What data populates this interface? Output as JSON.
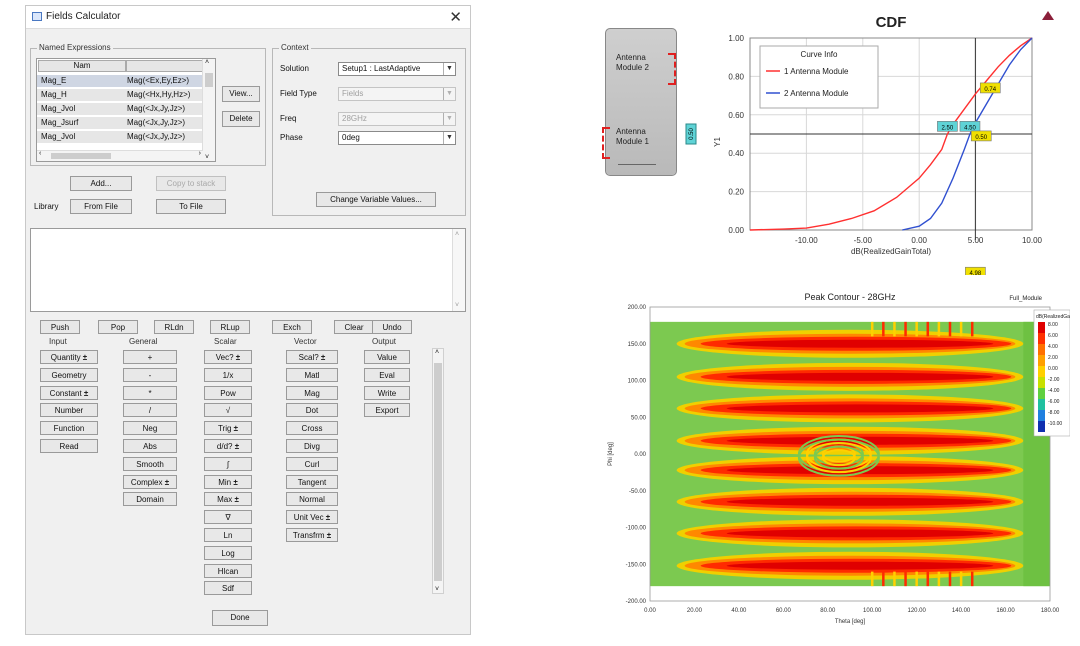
{
  "calculator": {
    "title": "Fields Calculator",
    "named_expression_group": "Named Expressions",
    "table_header": "Nam",
    "table_rows": [
      {
        "name": "Mag_E",
        "expr": "Mag(<Ex,Ey,Ez>)"
      },
      {
        "name": "Mag_H",
        "expr": "Mag(<Hx,Hy,Hz>)"
      },
      {
        "name": "Mag_Jvol",
        "expr": "Mag(<Jx,Jy,Jz>)"
      },
      {
        "name": "Mag_Jsurf",
        "expr": "Mag(<Jx,Jy,Jz>)"
      },
      {
        "name": "Mag_Jvol",
        "expr": "Mag(<Jx,Jy,Jz>)"
      }
    ],
    "view_label": "View...",
    "delete_label": "Delete",
    "add_label": "Add...",
    "copy_to_stack_label": "Copy to stack",
    "library_label": "Library",
    "from_file_label": "From File",
    "to_file_label": "To File",
    "context_group": "Context",
    "solution_label": "Solution",
    "solution_value": "Setup1 : LastAdaptive",
    "field_type_label": "Field Type",
    "field_type_value": "Fields",
    "freq_label": "Freq",
    "freq_value": "28GHz",
    "phase_label": "Phase",
    "phase_value": "0deg",
    "change_variables_label": "Change Variable Values...",
    "stack_buttons": [
      "Push",
      "Pop",
      "RLdn",
      "RLup",
      "Exch",
      "Clear",
      "Undo"
    ],
    "columns": {
      "input": {
        "header": "Input",
        "buttons": [
          {
            "label": "Quantity",
            "plus": true
          },
          {
            "label": "Geometry",
            "plus": false
          },
          {
            "label": "Constant",
            "plus": true
          },
          {
            "label": "Number",
            "plus": false
          },
          {
            "label": "Function",
            "plus": false
          },
          {
            "label": "Read",
            "plus": false
          }
        ]
      },
      "general": {
        "header": "General",
        "buttons": [
          {
            "label": "+",
            "plus": false
          },
          {
            "label": "-",
            "plus": false
          },
          {
            "label": "*",
            "plus": false
          },
          {
            "label": "/",
            "plus": false
          },
          {
            "label": "Neg",
            "plus": false
          },
          {
            "label": "Abs",
            "plus": false
          },
          {
            "label": "Smooth",
            "plus": false
          },
          {
            "label": "Complex",
            "plus": true
          },
          {
            "label": "Domain",
            "plus": false
          }
        ]
      },
      "scalar": {
        "header": "Scalar",
        "buttons": [
          {
            "label": "Vec?",
            "plus": true
          },
          {
            "label": "1/x",
            "plus": false
          },
          {
            "label": "Pow",
            "plus": false
          },
          {
            "label": "√",
            "plus": false
          },
          {
            "label": "Trig",
            "plus": true
          },
          {
            "label": "d/d?",
            "plus": true
          },
          {
            "label": "∫",
            "plus": false
          },
          {
            "label": "Min",
            "plus": true
          },
          {
            "label": "Max",
            "plus": true
          },
          {
            "label": "∇",
            "plus": false
          },
          {
            "label": "Ln",
            "plus": false
          },
          {
            "label": "Log",
            "plus": false
          },
          {
            "label": "Hlcan",
            "plus": false
          },
          {
            "label": "Sdf",
            "plus": false
          }
        ]
      },
      "vector": {
        "header": "Vector",
        "buttons": [
          {
            "label": "Scal?",
            "plus": true
          },
          {
            "label": "Matl",
            "plus": false
          },
          {
            "label": "Mag",
            "plus": false
          },
          {
            "label": "Dot",
            "plus": false
          },
          {
            "label": "Cross",
            "plus": false
          },
          {
            "label": "Divg",
            "plus": false
          },
          {
            "label": "Curl",
            "plus": false
          },
          {
            "label": "Tangent",
            "plus": false
          },
          {
            "label": "Normal",
            "plus": false
          },
          {
            "label": "Unit Vec",
            "plus": true
          },
          {
            "label": "Transfrm",
            "plus": true
          }
        ]
      },
      "output": {
        "header": "Output",
        "buttons": [
          {
            "label": "Value",
            "plus": false
          },
          {
            "label": "Eval",
            "plus": false
          },
          {
            "label": "Write",
            "plus": false
          },
          {
            "label": "Export",
            "plus": false
          }
        ]
      }
    },
    "done_label": "Done"
  },
  "geometry_box": {
    "top_label": "Antenna Module 2",
    "bottom_label": "Antenna Module 1"
  },
  "chart_data": [
    {
      "type": "line",
      "title": "CDF",
      "xlabel": "dB(RealizedGainTotal)",
      "ylabel": "Y1",
      "xlim": [
        -15,
        10
      ],
      "ylim": [
        0,
        1
      ],
      "xticks": [
        "-10.00",
        "-5.00",
        "0.00",
        "5.00",
        "10.00"
      ],
      "yticks": [
        "0.00",
        "0.20",
        "0.40",
        "0.60",
        "0.80",
        "1.00"
      ],
      "legend_title": "Curve Info",
      "series": [
        {
          "name": "1 Antenna Module",
          "color": "#ff3030",
          "x": [
            -15,
            -12,
            -10,
            -8,
            -6,
            -4,
            -2,
            0,
            1,
            2,
            2.5,
            3,
            4,
            5,
            6,
            7,
            8,
            9,
            10
          ],
          "y": [
            0,
            0.005,
            0.01,
            0.03,
            0.06,
            0.1,
            0.17,
            0.27,
            0.34,
            0.42,
            0.5,
            0.55,
            0.63,
            0.71,
            0.78,
            0.85,
            0.91,
            0.96,
            1.0
          ]
        },
        {
          "name": "2 Antenna Module",
          "color": "#3050d0",
          "x": [
            -1.5,
            0,
            1,
            2,
            3,
            4,
            4.5,
            5,
            6,
            7,
            8,
            9,
            10
          ],
          "y": [
            0,
            0.02,
            0.06,
            0.14,
            0.27,
            0.42,
            0.5,
            0.56,
            0.66,
            0.76,
            0.86,
            0.94,
            1.0
          ]
        }
      ],
      "markers": [
        {
          "text": "0.74",
          "x": 6.3,
          "y": 0.74,
          "color": "#f0e000"
        },
        {
          "text": "2.50",
          "x": 2.5,
          "y": 0.54,
          "color": "#5fd3d6"
        },
        {
          "text": "4.50",
          "x": 4.5,
          "y": 0.54,
          "color": "#5fd3d6"
        },
        {
          "text": "0.50",
          "x": 5.5,
          "y": 0.49,
          "color": "#f0e000"
        },
        {
          "text": "4.98",
          "x": 4.98,
          "y": -0.22,
          "color": "#f0e000"
        }
      ],
      "y_marker": {
        "text": "0.50",
        "value": 0.5,
        "color": "#5fd3d6"
      },
      "x_marker": 4.98
    },
    {
      "type": "heatmap",
      "title": "Peak Contour - 28GHz",
      "legend_label": "Full_Module",
      "xlabel": "Theta [deg]",
      "ylabel": "Phi [deg]",
      "xlim": [
        0,
        180
      ],
      "ylim": [
        -200,
        200
      ],
      "xticks": [
        "0.00",
        "20.00",
        "40.00",
        "60.00",
        "80.00",
        "100.00",
        "120.00",
        "140.00",
        "160.00",
        "180.00"
      ],
      "yticks": [
        "200.00",
        "150.00",
        "100.00",
        "50.00",
        "0.00",
        "-50.00",
        "-100.00",
        "-150.00",
        "-200.00"
      ],
      "colorbar_label": "dB(RealizedGainTotal)",
      "colorbar_ticks": [
        "8.00",
        "6.00",
        "4.00",
        "2.00",
        "0.00",
        "-2.00",
        "-4.00",
        "-6.00",
        "-8.00",
        "-10.00"
      ],
      "colorbar_colors": [
        "#e00000",
        "#ff3000",
        "#ff7000",
        "#ffa000",
        "#ffd000",
        "#c8e000",
        "#60d040",
        "#20c0a0",
        "#2080e0",
        "#1030b0"
      ]
    }
  ]
}
